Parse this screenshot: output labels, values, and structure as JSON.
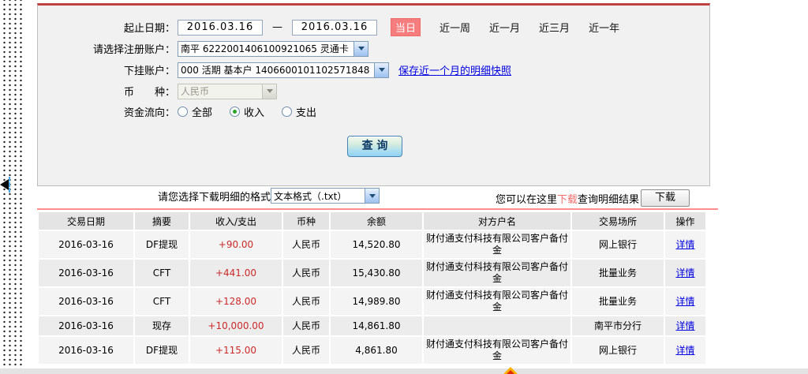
{
  "form": {
    "date_label": "起止日期：",
    "date_from": "2016.03.16",
    "date_to": "2016.03.16",
    "dash": "—",
    "today_badge": "当日",
    "quick_links": [
      "近一周",
      "近一月",
      "近三月",
      "近一年"
    ],
    "register_label": "请选择注册账户：",
    "register_value": "南平 6222001406100921065 灵通卡",
    "sub_label": "下挂账户：",
    "sub_value": "000 活期 基本户 1406600101102571848",
    "snapshot_link": "保存近一个月的明细快照",
    "currency_label": "币　　种：",
    "currency_value": "人民币",
    "flow_label": "资金流向：",
    "flow_options": [
      {
        "label": "全部",
        "selected": false
      },
      {
        "label": "收入",
        "selected": true
      },
      {
        "label": "支出",
        "selected": false
      }
    ],
    "query_button": "查 询"
  },
  "download": {
    "format_label": "请您选择下载明细的格式",
    "format_value": "文本格式（.txt）",
    "hint_prefix": "您可以在这里",
    "hint_download": "下载",
    "hint_suffix": "查询明细结果",
    "button": "下载"
  },
  "table": {
    "headers": [
      "交易日期",
      "摘要",
      "收入/支出",
      "币种",
      "余额",
      "对方户名",
      "交易场所",
      "操作"
    ],
    "rows": [
      {
        "date": "2016-03-16",
        "summary": "DF提现",
        "amount": "+90.00",
        "currency": "人民币",
        "balance": "14,520.80",
        "counterparty": "财付通支付科技有限公司客户备付金",
        "venue": "网上银行",
        "action": "详情"
      },
      {
        "date": "2016-03-16",
        "summary": "CFT",
        "amount": "+441.00",
        "currency": "人民币",
        "balance": "15,430.80",
        "counterparty": "财付通支付科技有限公司客户备付金",
        "venue": "批量业务",
        "action": "详情"
      },
      {
        "date": "2016-03-16",
        "summary": "CFT",
        "amount": "+128.00",
        "currency": "人民币",
        "balance": "14,989.80",
        "counterparty": "财付通支付科技有限公司客户备付金",
        "venue": "批量业务",
        "action": "详情"
      },
      {
        "date": "2016-03-16",
        "summary": "现存",
        "amount": "+10,000.00",
        "currency": "人民币",
        "balance": "14,861.80",
        "counterparty": "",
        "venue": "南平市分行",
        "action": "详情"
      },
      {
        "date": "2016-03-16",
        "summary": "DF提现",
        "amount": "+115.00",
        "currency": "人民币",
        "balance": "4,861.80",
        "counterparty": "财付通支付科技有限公司客户备付金",
        "venue": "网上银行",
        "action": "详情"
      }
    ]
  },
  "colors": {
    "badge_red": "#f57d7d",
    "amount_red": "#cc2929",
    "link_blue": "#0000e0",
    "panel_top_border": "#bf4242",
    "separator_red": "#ff8f8f"
  }
}
